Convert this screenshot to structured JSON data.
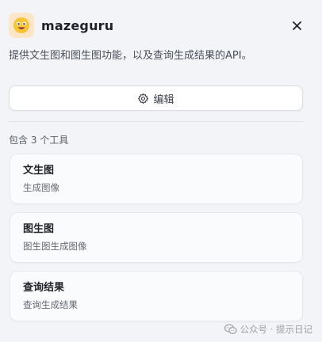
{
  "header": {
    "app_name": "mazeguru",
    "logo_icon": "smiley-face-icon",
    "close_icon": "close-icon"
  },
  "description": "提供文生图和图生图功能，以及查询生成结果的API。",
  "edit_button": {
    "label": "编辑",
    "icon": "gear-icon"
  },
  "tools_count_label": "包含 3 个工具",
  "tools": [
    {
      "title": "文生图",
      "subtitle": "生成图像"
    },
    {
      "title": "图生图",
      "subtitle": "图生图生成图像"
    },
    {
      "title": "查询结果",
      "subtitle": "查询生成结果"
    }
  ],
  "watermark": {
    "text": "公众号 · 提示日记",
    "icon": "wechat-icon"
  },
  "colors": {
    "logo_bg": "#fde6c8",
    "background": "#f3f4f7",
    "card_bg": "#fafbfc"
  }
}
